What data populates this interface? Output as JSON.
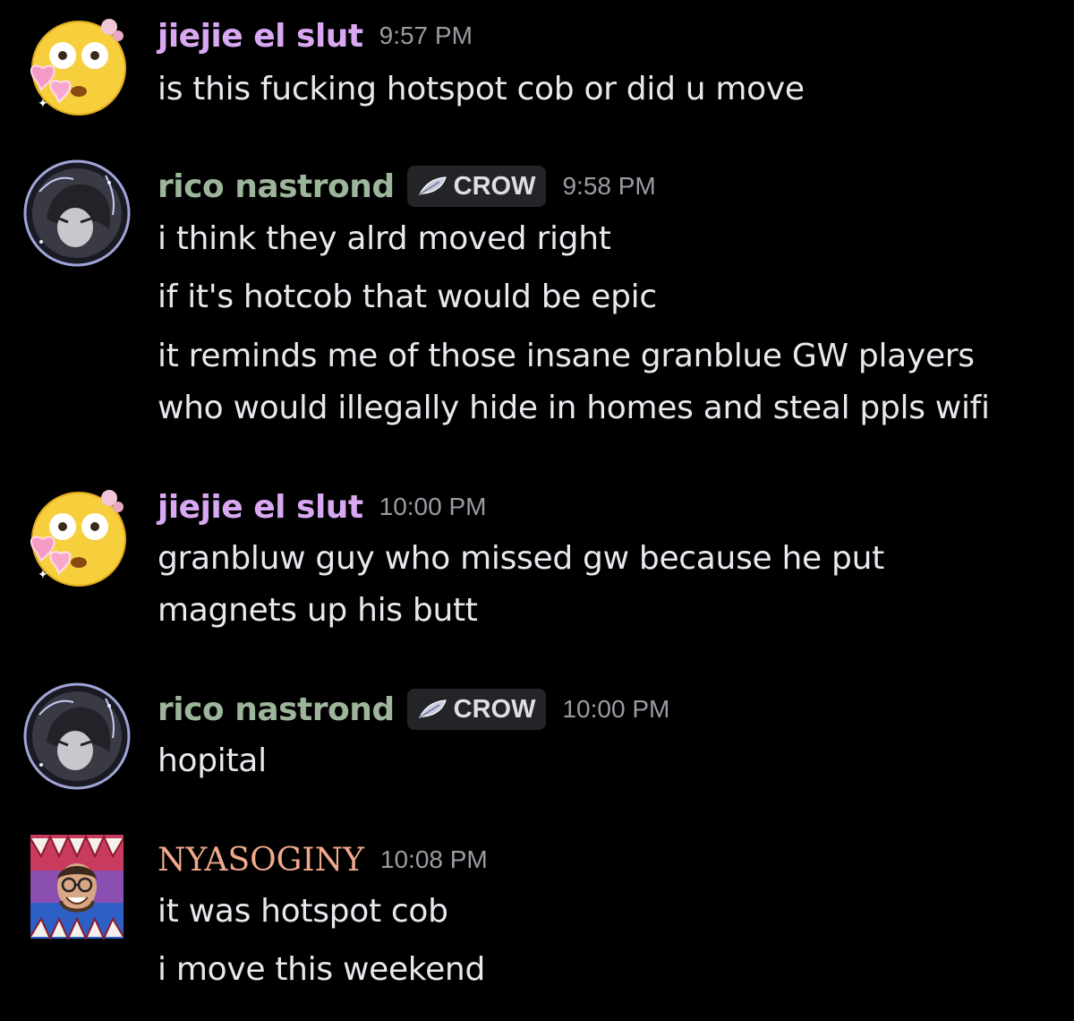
{
  "messages": [
    {
      "username": "jiejie el slut",
      "username_color": "#d8a8f2",
      "avatar": "dizzy-face-emoji",
      "time": "9:57 PM",
      "lines": [
        "is this fucking hotspot cob or did u move"
      ]
    },
    {
      "username": "rico nastrond",
      "username_color": "#9db59a",
      "avatar": "anime-character-avatar",
      "tag": "CROW",
      "tag_icon": "feather-icon",
      "time": "9:58 PM",
      "lines": [
        "i think they alrd moved right",
        "if it's hotcob that would be epic",
        "it reminds me of those insane granblue GW players",
        "who would illegally hide in homes and steal ppls wifi"
      ]
    },
    {
      "username": "jiejie el slut",
      "username_color": "#d8a8f2",
      "avatar": "dizzy-face-emoji",
      "time": "10:00 PM",
      "lines": [
        "granbluw guy who missed gw because he put",
        "magnets up his butt"
      ]
    },
    {
      "username": "rico nastrond",
      "username_color": "#9db59a",
      "avatar": "anime-character-avatar",
      "tag": "CROW",
      "tag_icon": "feather-icon",
      "time": "10:00 PM",
      "lines": [
        "hopital"
      ]
    },
    {
      "username": "NYASOGINY",
      "username_color": "#f0a98c",
      "avatar": "smiling-man-photo-avatar",
      "time": "10:08 PM",
      "lines": [
        "it was hotspot cob",
        "i move this weekend"
      ]
    }
  ]
}
